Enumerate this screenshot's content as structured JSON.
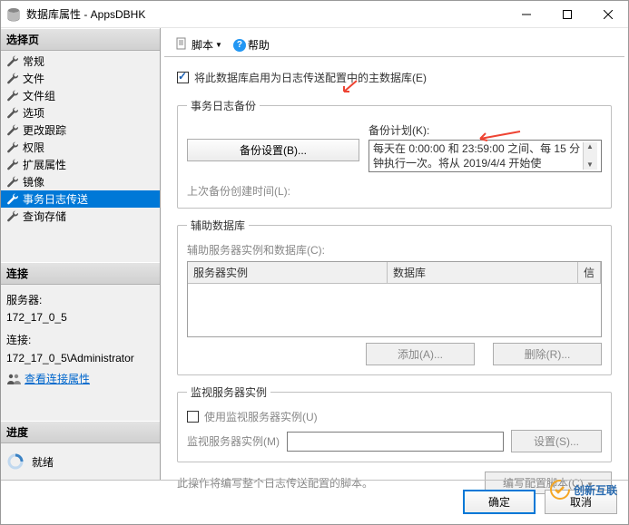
{
  "window": {
    "title": "数据库属性 - AppsDBHK"
  },
  "sidebar": {
    "select_page": "选择页",
    "pages": [
      "常规",
      "文件",
      "文件组",
      "选项",
      "更改跟踪",
      "权限",
      "扩展属性",
      "镜像",
      "事务日志传送",
      "查询存储"
    ],
    "selected_index": 8,
    "connection_header": "连接",
    "server_label": "服务器:",
    "server_value": "172_17_0_5",
    "conn_label": "连接:",
    "conn_value": "172_17_0_5\\Administrator",
    "view_conn_props": "查看连接属性",
    "progress_header": "进度",
    "progress_status": "就绪"
  },
  "toolbar": {
    "script": "脚本",
    "help": "帮助"
  },
  "form": {
    "enable_checkbox": "将此数据库启用为日志传送配置中的主数据库(E)",
    "backup_group": "事务日志备份",
    "backup_settings_btn": "备份设置(B)...",
    "backup_plan_label": "备份计划(K):",
    "backup_plan_text": "每天在 0:00:00 和 23:59:00 之间、每 15 分钟执行一次。将从 2019/4/4 开始使",
    "last_backup_label": "上次备份创建时间(L):",
    "secondary_group": "辅助数据库",
    "secondary_instances_label": "辅助服务器实例和数据库(C):",
    "col_server": "服务器实例",
    "col_db": "数据库",
    "col_trust": "信",
    "add_btn": "添加(A)...",
    "remove_btn": "删除(R)...",
    "monitor_group": "监视服务器实例",
    "use_monitor_checkbox": "使用监视服务器实例(U)",
    "monitor_instance_label": "监视服务器实例(M)",
    "monitor_settings_btn": "设置(S)...",
    "note": "此操作将编写整个日志传送配置的脚本。",
    "script_config_btn": "编写配置脚本(C)"
  },
  "footer": {
    "ok": "确定",
    "cancel": "取消"
  },
  "brand": {
    "text": "创新互联"
  }
}
